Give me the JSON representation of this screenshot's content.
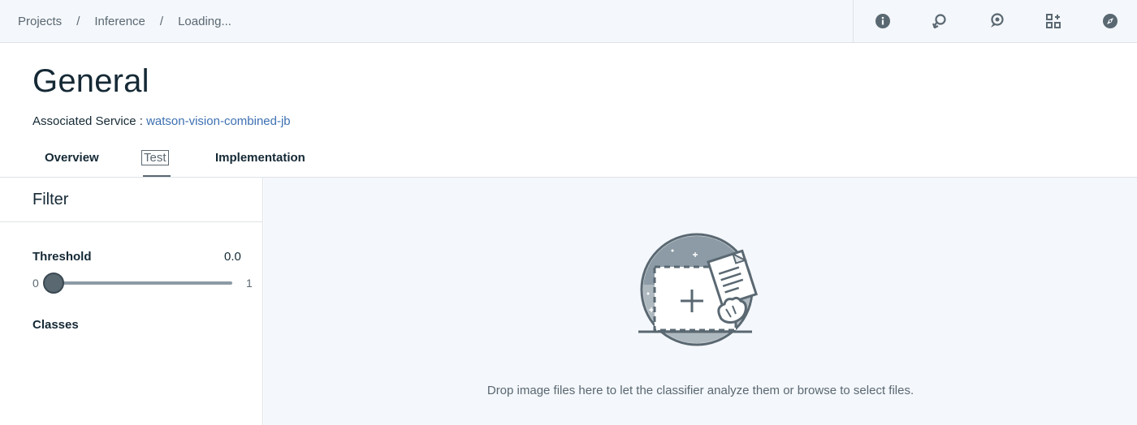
{
  "breadcrumb": {
    "items": [
      "Projects",
      "Inference",
      "Loading..."
    ],
    "separator": "/"
  },
  "toolbar": {
    "icons": [
      "info-icon",
      "refresh-icon",
      "chat-icon",
      "apps-icon",
      "compass-icon"
    ]
  },
  "page": {
    "title": "General",
    "associated_service_label": "Associated Service :",
    "associated_service_value": "watson-vision-combined-jb"
  },
  "tabs": [
    {
      "label": "Overview",
      "active": false
    },
    {
      "label": "Test",
      "active": true
    },
    {
      "label": "Implementation",
      "active": false
    }
  ],
  "filter": {
    "title": "Filter",
    "threshold_label": "Threshold",
    "threshold_value": "0.0",
    "slider_min": "0",
    "slider_max": "1",
    "slider_level": 0.0,
    "classes_label": "Classes"
  },
  "dropzone": {
    "text_before": "Drop image files here to let the classifier analyze them or",
    "browse_link": "browse",
    "text_after": "to select files."
  },
  "colors": {
    "topbar_bg": "#f4f7fb",
    "link": "#3d70b2",
    "text_primary": "#152935",
    "text_secondary": "#5a6872"
  }
}
